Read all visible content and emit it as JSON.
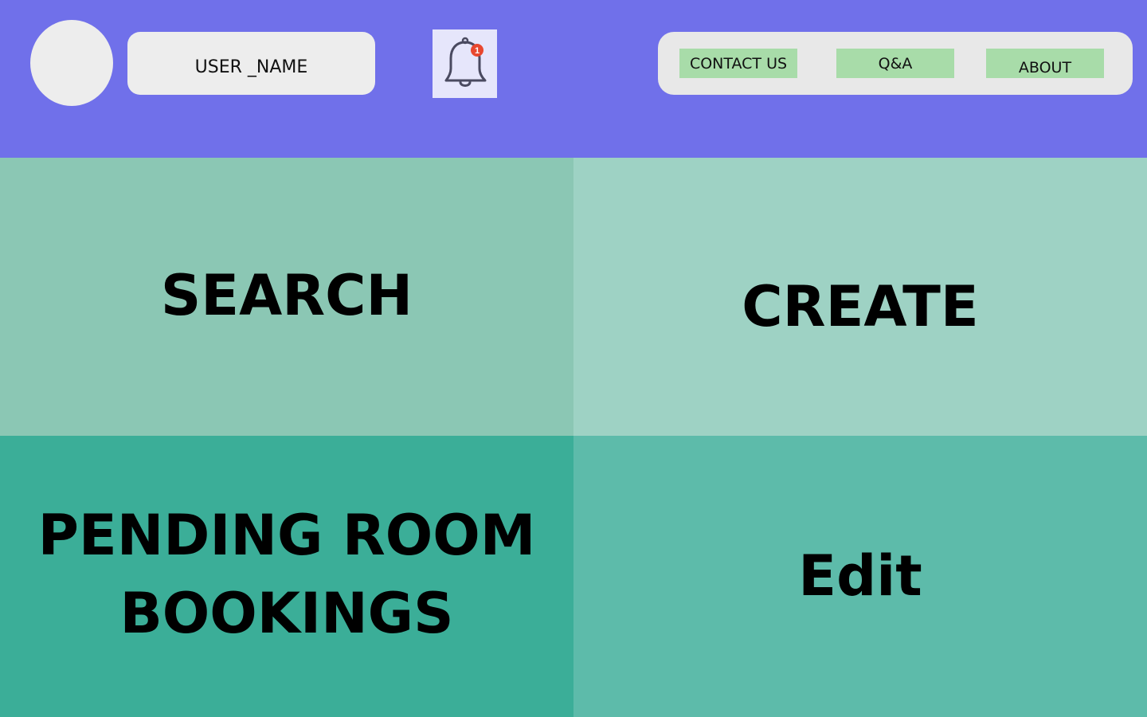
{
  "header": {
    "username": "USER _NAME",
    "notifications": {
      "icon": "bell-icon",
      "badge_count": "1"
    },
    "nav": {
      "contact_us": "CONTACT US",
      "qa": "Q&A",
      "about": "ABOUT"
    }
  },
  "tiles": {
    "search": "SEARCH",
    "create": "CREATE",
    "pending": "PENDING ROOM\nBOOKINGS",
    "edit": "Edit"
  },
  "colors": {
    "header_bg": "#7070EA",
    "nav_button_bg": "#A8DCA9",
    "badge": "#E8472F"
  }
}
